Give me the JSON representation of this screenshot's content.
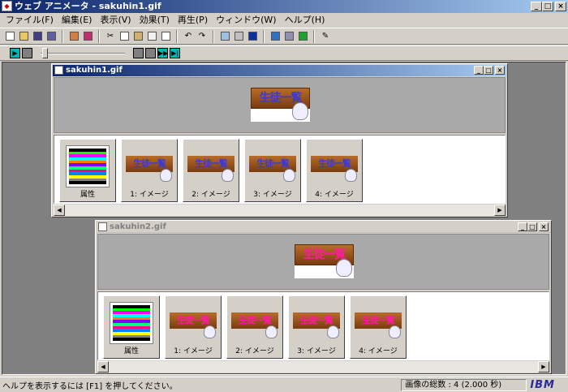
{
  "window": {
    "title": "ウェブ アニメータ - sakuhin1.gif",
    "icon": "app-icon"
  },
  "titlebar_buttons": [
    "_",
    "□",
    "×"
  ],
  "menu": [
    "ファイル(F)",
    "編集(E)",
    "表示(V)",
    "効果(T)",
    "再生(P)",
    "ウィンドウ(W)",
    "ヘルプ(H)"
  ],
  "toolbar": {
    "tools": [
      "new-icon",
      "open-icon",
      "save-icon",
      "save-as-icon",
      "wizard-icon",
      "palette-icon",
      "cut-icon",
      "copy-icon",
      "paste-icon",
      "eraser-icon",
      "duplicate-icon",
      "undo-icon",
      "redo-icon",
      "insert-icon",
      "frame-icon",
      "view-icon",
      "image-icon",
      "edit-image-icon",
      "text-effect-icon",
      "pencil-icon"
    ]
  },
  "playback": {
    "position": 0.0,
    "buttons": [
      "play-icon",
      "stop-icon",
      "first-frame-icon",
      "prev-frame-icon",
      "next-frame-icon",
      "last-frame-icon"
    ]
  },
  "documents": [
    {
      "title": "sakuhin1.gif",
      "active": true,
      "banner_text": "生徒一覧",
      "banner_color": "#3a3ad8",
      "frames": [
        {
          "label": "属性"
        },
        {
          "label": "1: イメージ"
        },
        {
          "label": "2: イメージ"
        },
        {
          "label": "3: イメージ"
        },
        {
          "label": "4: イメージ"
        }
      ]
    },
    {
      "title": "sakuhin2.gif",
      "active": false,
      "banner_text": "生徒一覧",
      "banner_color": "#ff1aa0",
      "frames": [
        {
          "label": "属性"
        },
        {
          "label": "1: イメージ"
        },
        {
          "label": "2: イメージ"
        },
        {
          "label": "3: イメージ"
        },
        {
          "label": "4: イメージ"
        }
      ]
    }
  ],
  "status": {
    "help": "ヘルプを表示するには [F1] を押してください。",
    "summary": "画像の総数 : 4 (2.000 秒)",
    "logo": "IBM"
  },
  "palette_colors": [
    "#000000",
    "#00ff00",
    "#ff00ff",
    "#00ffff",
    "#ff8000",
    "#8000ff",
    "#00ff80",
    "#ff0080",
    "#0080ff",
    "#80ff00",
    "#ff4040",
    "#40ff40",
    "#4040ff",
    "#ffff00",
    "#808080",
    "#000000"
  ]
}
